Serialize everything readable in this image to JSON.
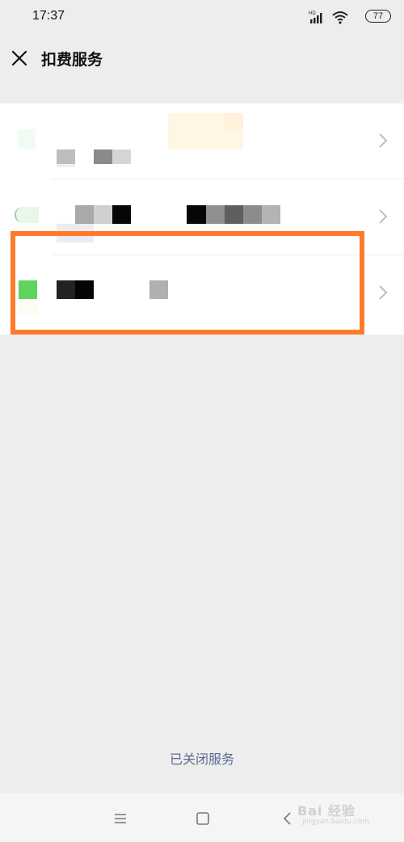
{
  "status_bar": {
    "time": "17:37",
    "battery": "77",
    "icons": [
      "hd-signal-icon",
      "wifi-icon",
      "battery-icon"
    ]
  },
  "header": {
    "title": "扣费服务",
    "close_icon": "close-icon"
  },
  "list": {
    "items": [
      {
        "label": "",
        "obscured": true
      },
      {
        "label": "",
        "obscured": true
      },
      {
        "label": "",
        "obscured": true,
        "highlighted": true,
        "icon_color": "#5ed45e"
      }
    ]
  },
  "footer": {
    "closed_services_link": "已关闭服务"
  },
  "nav_bar": {
    "buttons": [
      "menu-icon",
      "home-icon",
      "back-icon"
    ]
  },
  "watermark": {
    "main": "Bai 经验",
    "sub": "jingyan.baidu.com"
  },
  "colors": {
    "highlight": "#ff7a2b",
    "link": "#5a6c92",
    "background": "#ededed"
  }
}
